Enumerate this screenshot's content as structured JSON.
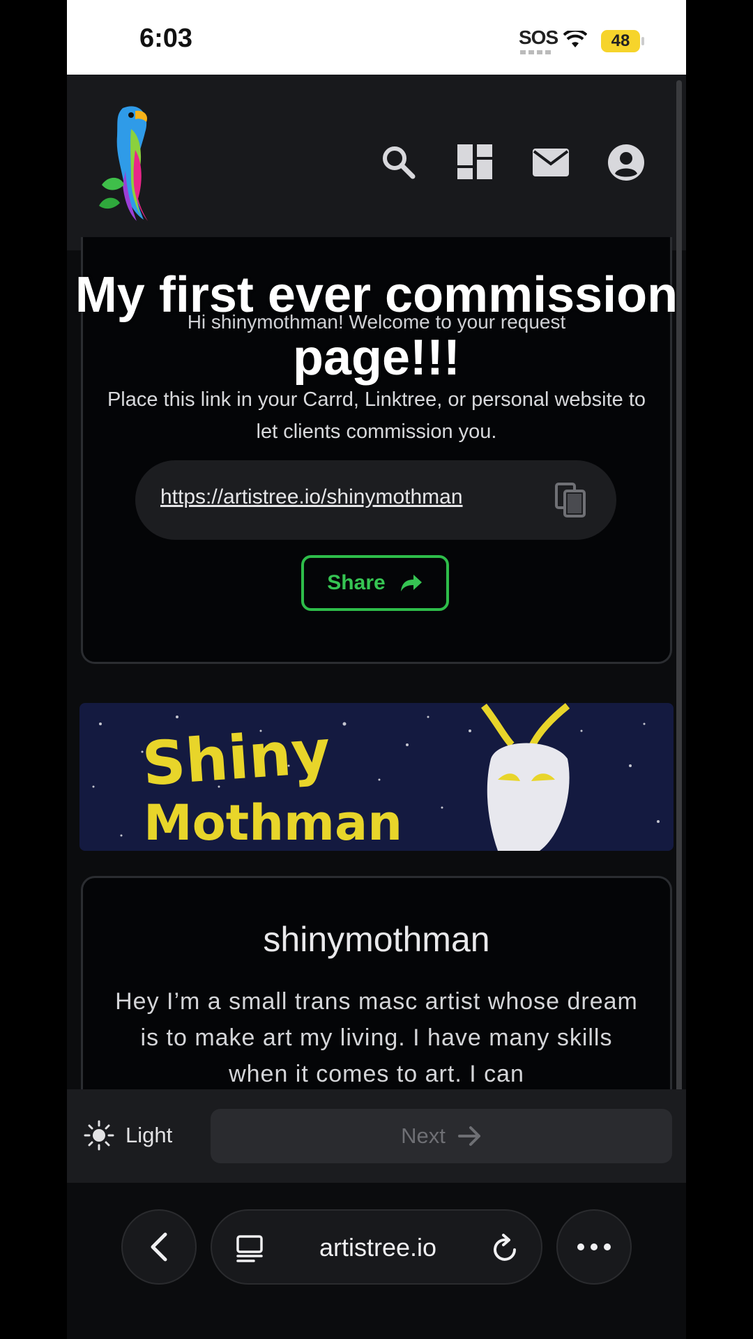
{
  "status_bar": {
    "time": "6:03",
    "sos": "SOS",
    "battery": "48"
  },
  "header": {
    "icons": [
      "parrot-logo-icon",
      "search-icon",
      "dashboard-icon",
      "mail-icon",
      "account-icon"
    ]
  },
  "overlay_caption": "My first ever commission page!!!",
  "request_card": {
    "welcome_text": "Hi shinymothman! Welcome to your request",
    "instructions": "Place this link in your Carrd, Linktree, or personal website to let clients commission you.",
    "link": "https://artistree.io/shinymothman",
    "share_label": "Share"
  },
  "banner": {
    "line1": "Shiny",
    "line2": "Mothman"
  },
  "profile": {
    "username": "shinymothman",
    "bio": "Hey I’m a small trans masc artist whose dream is to make art my living. I have many skills when it comes to art. I can"
  },
  "action_bar": {
    "theme_label": "Light",
    "next_label": "Next"
  },
  "browser": {
    "domain": "artistree.io"
  },
  "colors": {
    "accent_green": "#2ebd4a",
    "battery_yellow": "#f6d42b",
    "background": "#0b0c0e"
  }
}
